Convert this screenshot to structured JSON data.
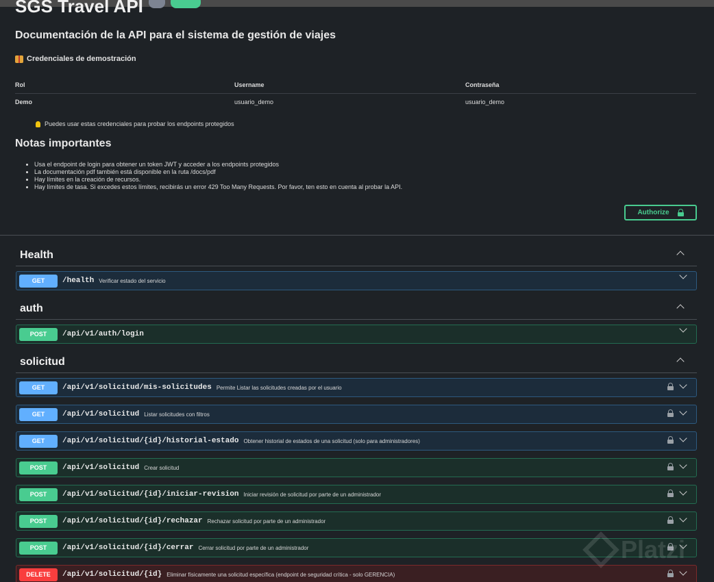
{
  "info": {
    "title": "SGS Travel API",
    "description": "Documentación de la API para el sistema de gestión de viajes",
    "credentials_heading": "Credenciales de demostración",
    "credentials_table": {
      "headers": [
        "Rol",
        "Username",
        "Contraseña"
      ],
      "rows": [
        [
          "Demo",
          "usuario_demo",
          "usuario_demo"
        ]
      ]
    },
    "tip": "Puedes usar estas credenciales para probar los endpoints protegidos",
    "notes_title": "Notas importantes",
    "notes": [
      "Usa el endpoint de login para obtener un token JWT y acceder a los endpoints protegidos",
      "La documentación pdf también está disponible en la ruta /docs/pdf",
      "Hay límites en la creación de recursos.",
      "Hay límites de tasa. Si excedes estos límites, recibirás un error 429 Too Many Requests. Por favor, ten esto en cuenta al probar la API."
    ],
    "authorize_label": "Authorize"
  },
  "sections": [
    {
      "name": "Health",
      "operations": [
        {
          "method": "GET",
          "path": "/health",
          "summary": "Verificar estado del servicio",
          "locked": false
        }
      ]
    },
    {
      "name": "auth",
      "operations": [
        {
          "method": "POST",
          "path": "/api/v1/auth/login",
          "summary": "",
          "locked": false
        }
      ]
    },
    {
      "name": "solicitud",
      "operations": [
        {
          "method": "GET",
          "path": "/api/v1/solicitud/mis-solicitudes",
          "summary": "Permite Listar las solicitudes creadas por el usuario",
          "locked": true
        },
        {
          "method": "GET",
          "path": "/api/v1/solicitud",
          "summary": "Listar solicitudes con filtros",
          "locked": true
        },
        {
          "method": "GET",
          "path": "/api/v1/solicitud/{id}/historial-estado",
          "summary": "Obtener historial de estados de una solicitud (solo para administradores)",
          "locked": true
        },
        {
          "method": "POST",
          "path": "/api/v1/solicitud",
          "summary": "Crear solicitud",
          "locked": true
        },
        {
          "method": "POST",
          "path": "/api/v1/solicitud/{id}/iniciar-revision",
          "summary": "Iniciar revisión de solicitud por parte de un administrador",
          "locked": true
        },
        {
          "method": "POST",
          "path": "/api/v1/solicitud/{id}/rechazar",
          "summary": "Rechazar solicitud por parte de un administrador",
          "locked": true
        },
        {
          "method": "POST",
          "path": "/api/v1/solicitud/{id}/cerrar",
          "summary": "Cerrar solicitud por parte de un administrador",
          "locked": true
        },
        {
          "method": "DELETE",
          "path": "/api/v1/solicitud/{id}",
          "summary": "Eliminar físicamente una solicitud específica (endpoint de seguridad crítica - solo GERENCIA)",
          "locked": true
        }
      ]
    }
  ],
  "watermark": "Platzi",
  "colors": {
    "get": "#61affe",
    "post": "#49cc90",
    "delete": "#f93e3e",
    "background": "#1e2226"
  }
}
